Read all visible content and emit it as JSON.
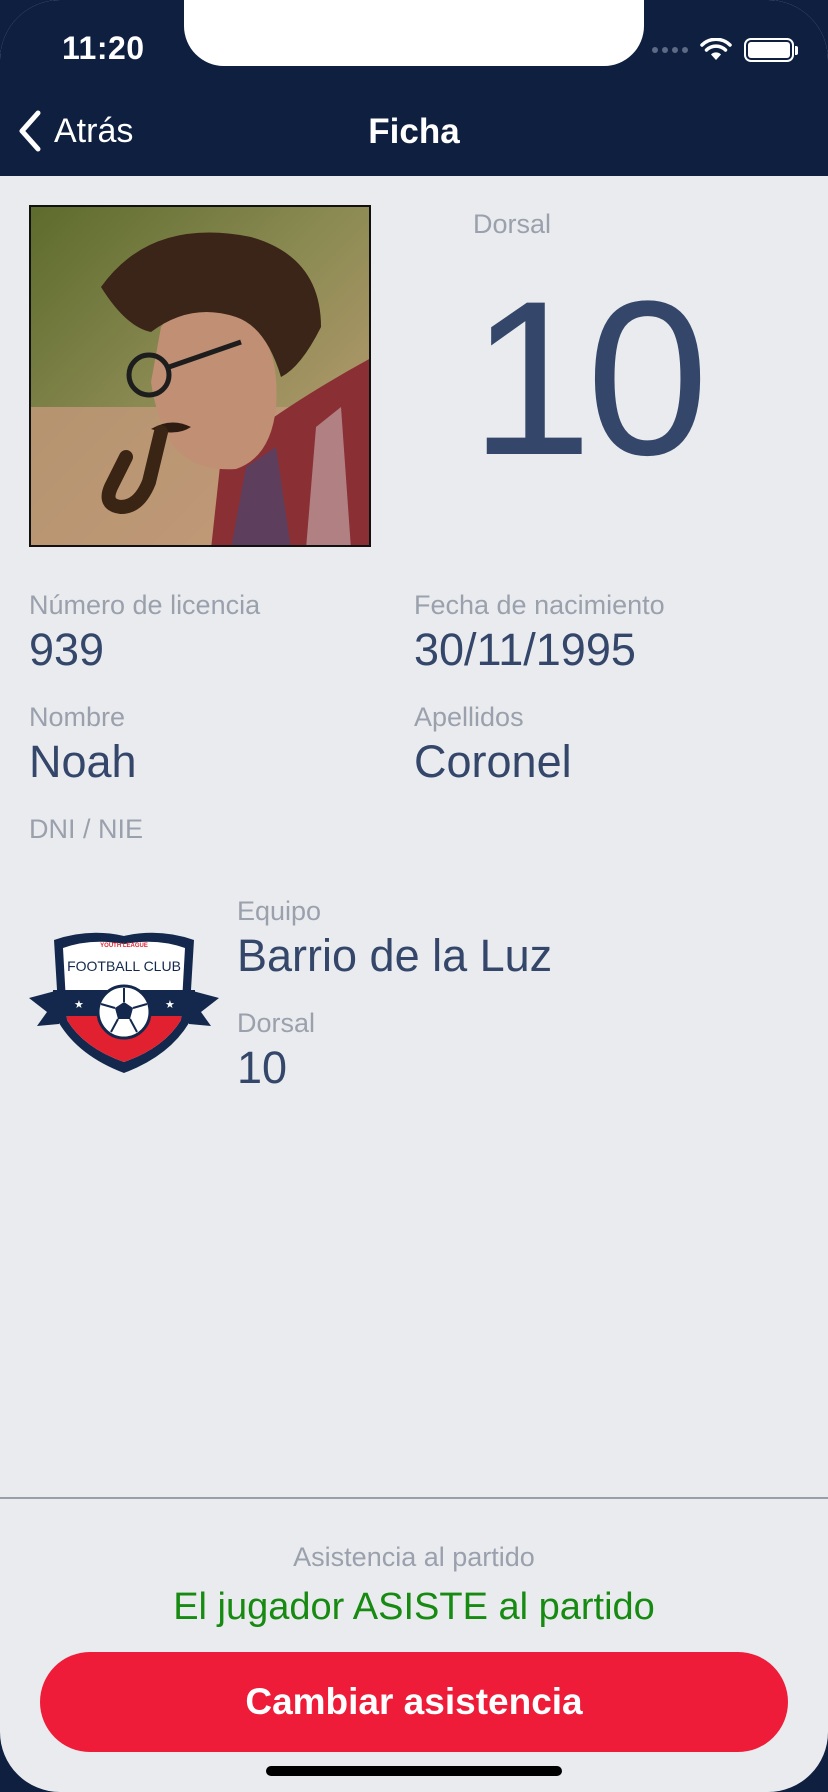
{
  "status_bar": {
    "time": "11:20"
  },
  "nav": {
    "back_label": "Atrás",
    "title": "Ficha"
  },
  "player": {
    "dorsal_label": "Dorsal",
    "dorsal_number": "10",
    "license_label": "Número de licencia",
    "license_value": "939",
    "birthdate_label": "Fecha de nacimiento",
    "birthdate_value": "30/11/1995",
    "name_label": "Nombre",
    "name_value": "Noah",
    "surname_label": "Apellidos",
    "surname_value": "Coronel",
    "dni_label": "DNI / NIE"
  },
  "team": {
    "logo_text_top": "YOUTH LEAGUE",
    "logo_text_main": "FOOTBALL CLUB",
    "team_label": "Equipo",
    "team_value": "Barrio de la Luz",
    "dorsal_label": "Dorsal",
    "dorsal_value": "10"
  },
  "attendance": {
    "label": "Asistencia al partido",
    "status": "El jugador ASISTE al partido",
    "button_label": "Cambiar asistencia"
  },
  "colors": {
    "header_bg": "#0e1f40",
    "screen_bg": "#eaebef",
    "value_text": "#34476a",
    "label_text": "#9aa1ad",
    "status_green": "#178a12",
    "button_red": "#ee1c38"
  }
}
